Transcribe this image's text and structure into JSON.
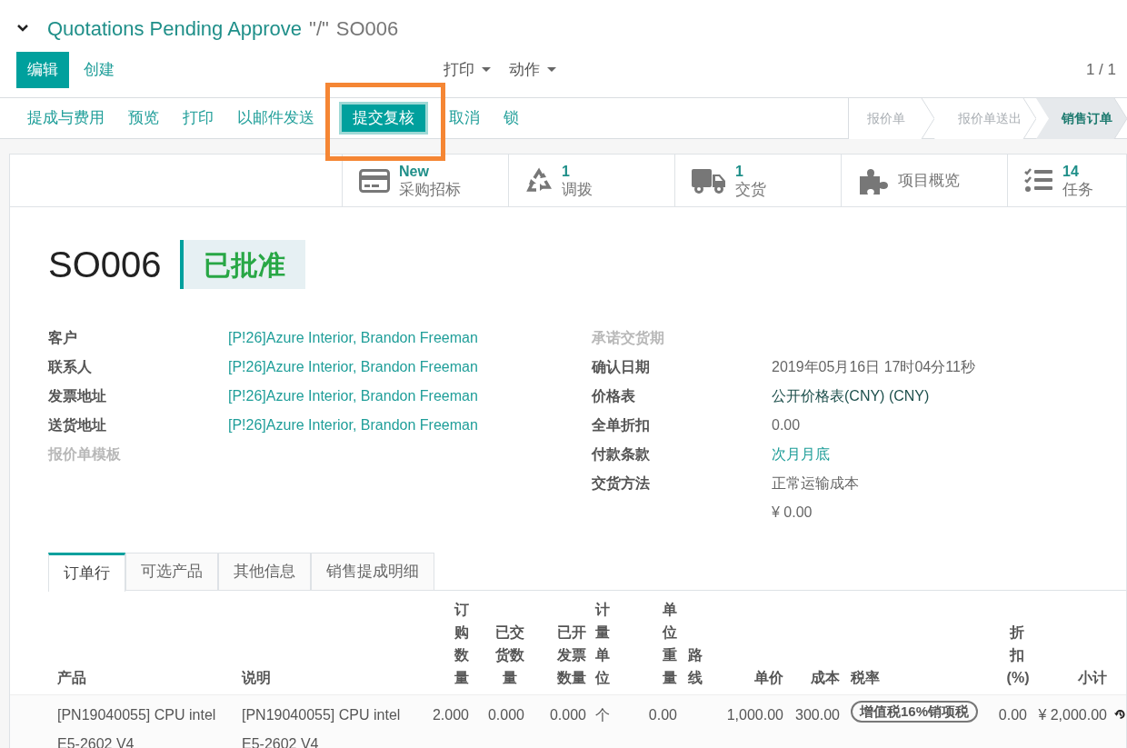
{
  "breadcrumb": {
    "collapse_icon": true,
    "parent": "Quotations Pending Approve",
    "separator": "\"/\"",
    "current": "SO006"
  },
  "control_buttons": [
    {
      "label": "编辑",
      "kind": "primary"
    },
    {
      "label": "创建",
      "kind": "link"
    }
  ],
  "dropdowns": [
    {
      "label": "打印"
    },
    {
      "label": "动作"
    }
  ],
  "pager": "1 / 1",
  "action_buttons": [
    {
      "label": "提成与费用",
      "kind": "link",
      "highlighted": false
    },
    {
      "label": "预览",
      "kind": "link",
      "highlighted": false
    },
    {
      "label": "打印",
      "kind": "link",
      "highlighted": false
    },
    {
      "label": "以邮件发送",
      "kind": "link",
      "highlighted": false
    },
    {
      "label": "提交复核",
      "kind": "primary",
      "highlighted": true
    },
    {
      "label": "取消",
      "kind": "link",
      "highlighted": false
    },
    {
      "label": "锁",
      "kind": "link",
      "highlighted": false
    }
  ],
  "stages": [
    {
      "label": "报价单",
      "selected": false
    },
    {
      "label": "报价单送出",
      "selected": false
    },
    {
      "label": "销售订单",
      "selected": true
    }
  ],
  "smart_buttons": [
    {
      "kind": "card",
      "value": "New",
      "label": "采购招标"
    },
    {
      "kind": "recycle",
      "value": "1",
      "label": "调拨"
    },
    {
      "kind": "truck",
      "value": "1",
      "label": "交货"
    },
    {
      "kind": "puzzle",
      "label": "项目概览"
    },
    {
      "kind": "tasks",
      "value": "14",
      "label": "任务"
    }
  ],
  "order_name": "SO006",
  "state_badge": "已批准",
  "left_fields": [
    {
      "label": "客户",
      "value": "[P!26]Azure Interior, Brandon Freeman",
      "kind": "link"
    },
    {
      "label": "联系人",
      "value": "[P!26]Azure Interior, Brandon Freeman",
      "kind": "link"
    },
    {
      "label": "发票地址",
      "value": "[P!26]Azure Interior, Brandon Freeman",
      "kind": "link"
    },
    {
      "label": "送货地址",
      "value": "[P!26]Azure Interior, Brandon Freeman",
      "kind": "link"
    },
    {
      "label": "报价单模板",
      "kind": "empty"
    }
  ],
  "right_fields": [
    {
      "label": "承诺交货期",
      "kind": "empty"
    },
    {
      "label": "确认日期",
      "value": "2019年05月16日 17时04分11秒",
      "kind": "text"
    },
    {
      "label": "价格表",
      "value": "公开价格表(CNY) (CNY)",
      "kind": "dark"
    },
    {
      "label": "全单折扣",
      "value": "0.00",
      "kind": "text"
    },
    {
      "label": "付款条款",
      "value": "次月月底",
      "kind": "link"
    },
    {
      "label": "交货方法",
      "value": "正常运输成本",
      "kind": "text"
    },
    {
      "value": "¥ 0.00",
      "kind": "text"
    }
  ],
  "tabs": [
    {
      "label": "订单行",
      "selected": true
    },
    {
      "label": "可选产品",
      "selected": false
    },
    {
      "label": "其他信息",
      "selected": false
    },
    {
      "label": "销售提成明细",
      "selected": false
    }
  ],
  "table": {
    "columns": [
      "产品",
      "说明",
      "订购数量",
      "已交货数量",
      "已开发票数量",
      "计量单位",
      "单位重量",
      "路线",
      "单价",
      "成本",
      "税率",
      "折扣(%)",
      "小计"
    ],
    "rows": [
      {
        "cells": [
          "[PN19040055] CPU intel E5-2602 V4",
          "[PN19040055] CPU intel E5-2602 V4",
          "2.000",
          "0.000",
          "0.000",
          "个",
          "0.00",
          "",
          "1,000.00",
          "300.00",
          "增值税16%销项税",
          "0.00",
          "¥ 2,000.00"
        ]
      }
    ]
  }
}
